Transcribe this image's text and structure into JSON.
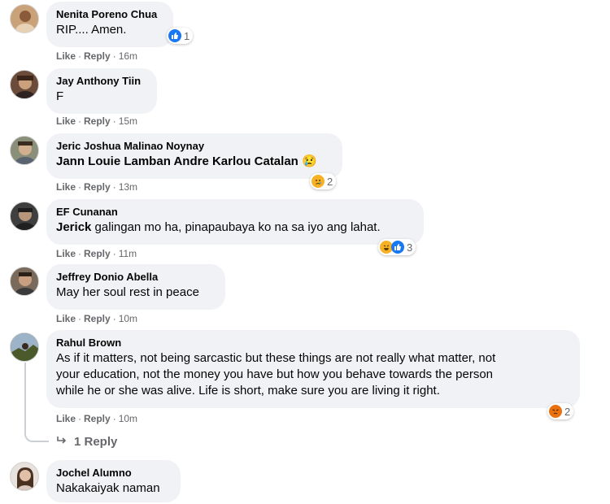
{
  "comments": [
    {
      "author": "Nenita Poreno Chua",
      "text": "RIP.... Amen.",
      "like": "Like",
      "reply": "Reply",
      "time": "16m",
      "reactions": {
        "icons": [
          "like-icon"
        ],
        "count": "1"
      },
      "avatar_color": "#c9a27a"
    },
    {
      "author": "Jay Anthony Tiin",
      "text": "F",
      "like": "Like",
      "reply": "Reply",
      "time": "15m",
      "avatar_color": "#6b4c3b"
    },
    {
      "author": "Jeric Joshua Malinao Noynay",
      "tag": "Jann Louie Lamban Andre Karlou Catalan",
      "text": "😢",
      "like": "Like",
      "reply": "Reply",
      "time": "13m",
      "reactions": {
        "icons": [
          "sad-icon"
        ],
        "count": "2"
      },
      "avatar_color": "#8a8f7a"
    },
    {
      "author": "EF Cunanan",
      "tag": "Jerick",
      "text": "galingan mo ha, pinapaubaya ko na sa iyo ang lahat.",
      "like": "Like",
      "reply": "Reply",
      "time": "11m",
      "reactions": {
        "icons": [
          "haha-icon",
          "like-icon"
        ],
        "count": "3"
      },
      "avatar_color": "#3f3f3f"
    },
    {
      "author": "Jeffrey Donio Abella",
      "text": "May her soul rest in peace",
      "like": "Like",
      "reply": "Reply",
      "time": "10m",
      "avatar_color": "#7a6a5c"
    },
    {
      "author": "Rahul Brown",
      "text_lines": [
        "As if it matters, not being sarcastic but these things are not really what matter, not",
        "your education, not the money you have but how you behave towards the person",
        "while he or she was alive. Life is short, make sure you are living it right."
      ],
      "like": "Like",
      "reply": "Reply",
      "time": "10m",
      "reactions": {
        "icons": [
          "angry-icon"
        ],
        "count": "2"
      },
      "replies_link": "1 Reply",
      "avatar_color": "#5a6b3a"
    },
    {
      "author": "Jochel Alumno",
      "text": "Nakakaiyak naman",
      "avatar_color": "#b59a8a"
    }
  ],
  "colors": {
    "bubble": "#f0f2f5",
    "meta": "#65676b",
    "like_blue": "#1877f2",
    "emoji_yellow": "#f7b125",
    "angry_orange": "#e9710f"
  }
}
